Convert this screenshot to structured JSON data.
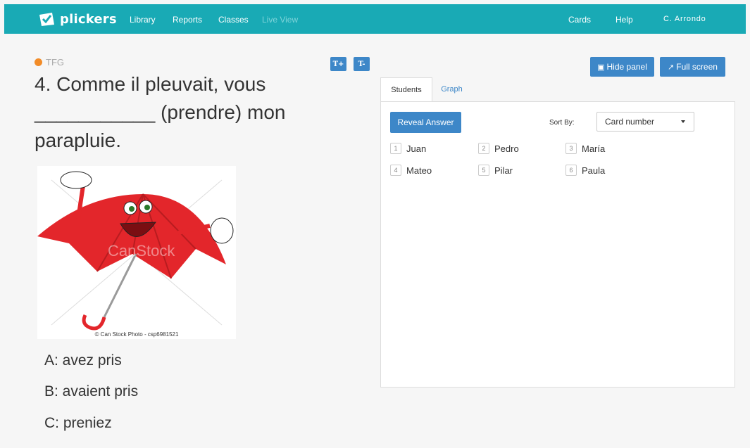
{
  "nav": {
    "brand": "plickers",
    "links": [
      "Library",
      "Reports",
      "Classes",
      "Live View"
    ],
    "right": [
      "Cards",
      "Help",
      "C. Arrondo"
    ]
  },
  "question": {
    "deck": "TFG",
    "text": "4. Comme il pleuvait, vous ___________ (prendre) mon parapluie.",
    "image_credit": "© Can Stock Photo - csp6981521",
    "watermark": "CanStock",
    "answers": [
      "A: avez pris",
      "B: avaient pris",
      "C: preniez"
    ],
    "size_buttons": [
      "T+",
      "T-"
    ]
  },
  "panel_buttons": {
    "hide": "Hide panel",
    "fullscreen": "Full screen"
  },
  "tabs": [
    "Students",
    "Graph"
  ],
  "panel": {
    "reveal_label": "Reveal Answer",
    "sort_label": "Sort By:",
    "sort_value": "Card number",
    "students": [
      {
        "num": "1",
        "name": "Juan"
      },
      {
        "num": "2",
        "name": "Pedro"
      },
      {
        "num": "3",
        "name": "María"
      },
      {
        "num": "4",
        "name": "Mateo"
      },
      {
        "num": "5",
        "name": "Pilar"
      },
      {
        "num": "6",
        "name": "Paula"
      }
    ]
  },
  "colors": {
    "topbar": "#19aab5",
    "button": "#3d87c8",
    "deck_dot": "#f28c28"
  }
}
